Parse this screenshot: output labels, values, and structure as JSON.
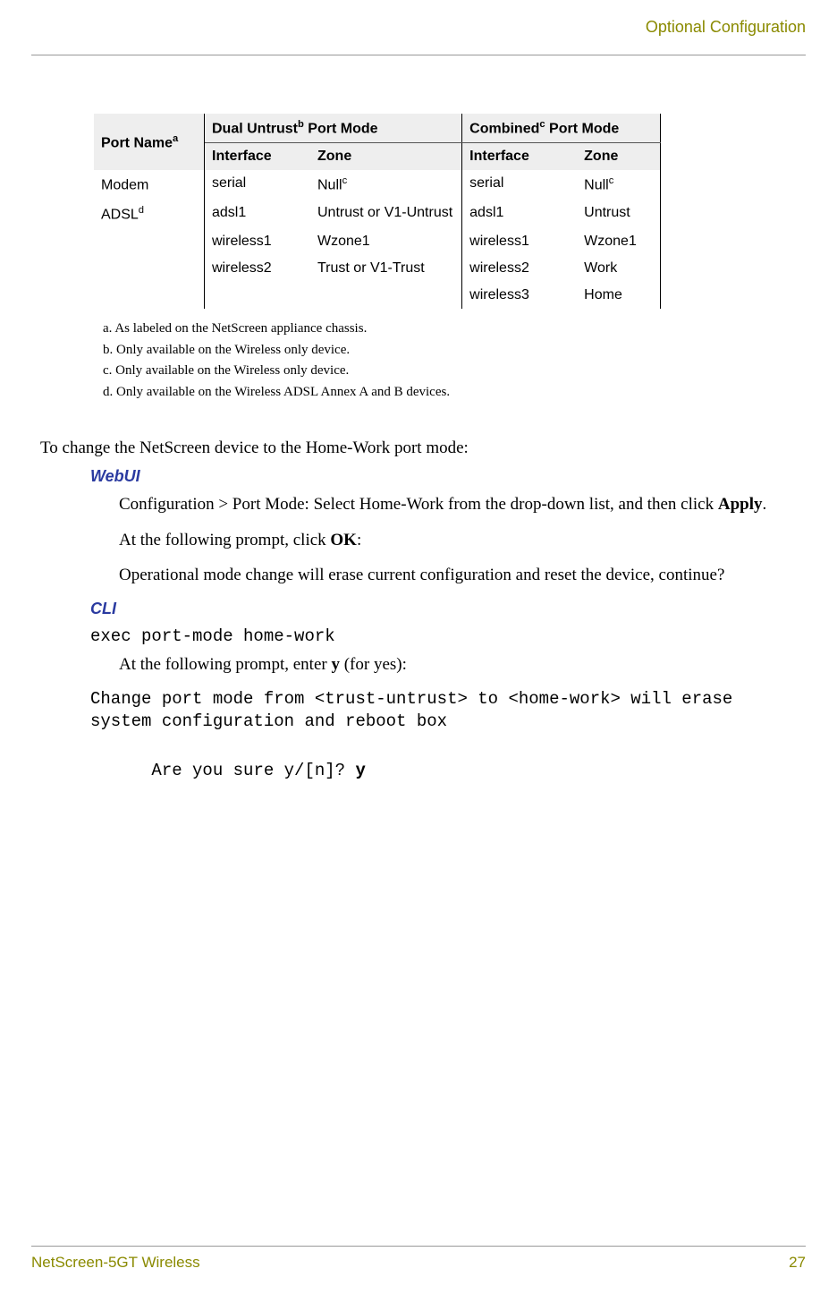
{
  "header": {
    "section_title": "Optional Configuration"
  },
  "table": {
    "col_portname": "Port Name",
    "col_portname_sup": "a",
    "grp_dual": "Dual Untrust",
    "grp_dual_sup": "b",
    "grp_dual_tail": " Port Mode",
    "grp_comb": "Combined",
    "grp_comb_sup": "c",
    "grp_comb_tail": " Port Mode",
    "sub_interface": "Interface",
    "sub_zone": "Zone",
    "rows": [
      {
        "port": "Modem",
        "port_sup": "",
        "i1": "serial",
        "z1": "Null",
        "z1_sup": "c",
        "i2": "serial",
        "z2": "Null",
        "z2_sup": "c"
      },
      {
        "port": "ADSL",
        "port_sup": "d",
        "i1": "adsl1",
        "z1": "Untrust or V1-Untrust",
        "z1_sup": "",
        "i2": "adsl1",
        "z2": "Untrust",
        "z2_sup": ""
      },
      {
        "port": "",
        "port_sup": "",
        "i1": "wireless1",
        "z1": "Wzone1",
        "z1_sup": "",
        "i2": "wireless1",
        "z2": "Wzone1",
        "z2_sup": ""
      },
      {
        "port": "",
        "port_sup": "",
        "i1": "wireless2",
        "z1": "Trust or V1-Trust",
        "z1_sup": "",
        "i2": "wireless2",
        "z2": "Work",
        "z2_sup": ""
      },
      {
        "port": "",
        "port_sup": "",
        "i1": "",
        "z1": "",
        "z1_sup": "",
        "i2": "wireless3",
        "z2": "Home",
        "z2_sup": ""
      }
    ]
  },
  "footnotes": {
    "a": "a.   As labeled on the NetScreen appliance chassis.",
    "b": "b.  Only available on the Wireless only device.",
    "c": "c.  Only available on the Wireless only device.",
    "d": "d.   Only available on the Wireless ADSL Annex A and B devices."
  },
  "body": {
    "intro": "To change the NetScreen device to the Home-Work port mode:",
    "webui_heading": "WebUI",
    "webui_p1_pre": "Configuration > Port Mode: Select Home-Work from the drop-down list, and then click ",
    "webui_p1_bold": "Apply",
    "webui_p1_post": ".",
    "webui_p2_pre": "At the following prompt, click ",
    "webui_p2_bold": "OK",
    "webui_p2_post": ":",
    "webui_p3": "Operational mode change will erase current configuration and reset the device, continue?",
    "cli_heading": "CLI",
    "cli_cmd": "exec port-mode home-work",
    "cli_p1_pre": "At the following prompt, enter ",
    "cli_p1_bold": "y",
    "cli_p1_post": " (for yes):",
    "cli_out1": "Change port mode from <trust-untrust> to <home-work> will erase system configuration and reboot box",
    "cli_out2_pre": "Are you sure y/[n]? ",
    "cli_out2_bold": "y"
  },
  "footer": {
    "product": "NetScreen-5GT Wireless",
    "page": "27"
  }
}
